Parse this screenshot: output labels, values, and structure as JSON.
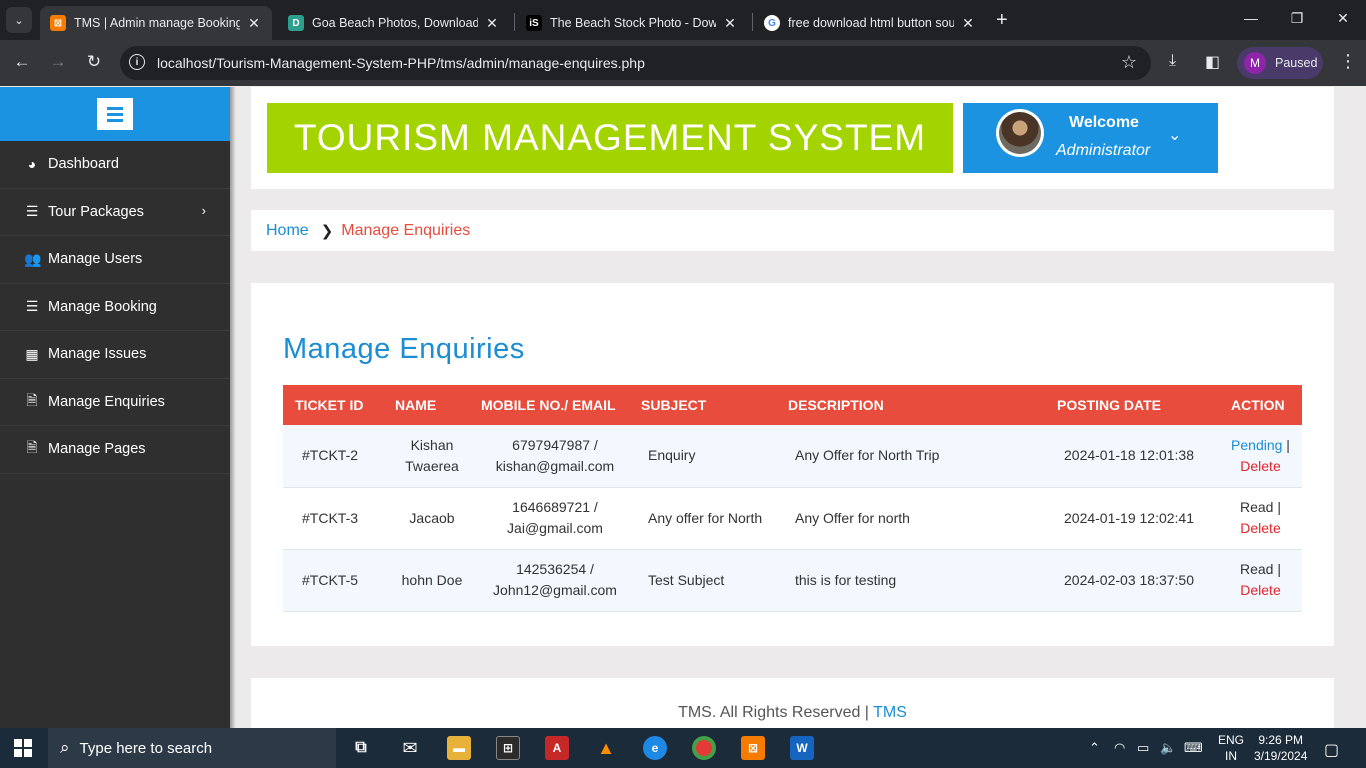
{
  "browser": {
    "tabs": [
      {
        "title": "TMS | Admin manage Bookings",
        "active": true
      },
      {
        "title": "Goa Beach Photos, Download T",
        "active": false
      },
      {
        "title": "The Beach Stock Photo - Downl",
        "active": false
      },
      {
        "title": "free download html button sou",
        "active": false
      }
    ],
    "url": "localhost/Tourism-Management-System-PHP/tms/admin/manage-enquires.php",
    "profile_initial": "M",
    "profile_status": "Paused"
  },
  "sidebar": {
    "items": [
      {
        "label": "Dashboard",
        "icon": "dashboard-icon",
        "glyph": "◕"
      },
      {
        "label": "Tour Packages",
        "icon": "list-icon",
        "glyph": "☰",
        "has_submenu": true
      },
      {
        "label": "Manage Users",
        "icon": "users-icon",
        "glyph": "👥"
      },
      {
        "label": "Manage Booking",
        "icon": "list-icon",
        "glyph": "☰"
      },
      {
        "label": "Manage Issues",
        "icon": "table-icon",
        "glyph": "▦"
      },
      {
        "label": "Manage Enquiries",
        "icon": "file-icon",
        "glyph": "🗎"
      },
      {
        "label": "Manage Pages",
        "icon": "file-icon",
        "glyph": "🗎"
      }
    ]
  },
  "header": {
    "brand": "TOURISM MANAGEMENT SYSTEM",
    "welcome": "Welcome",
    "role": "Administrator"
  },
  "breadcrumb": {
    "home": "Home",
    "current": "Manage Enquiries"
  },
  "main": {
    "title": "Manage Enquiries",
    "columns": [
      "TICKET ID",
      "NAME",
      "MOBILE NO./ EMAIL",
      "SUBJECT",
      "DESCRIPTION",
      "POSTING DATE",
      "ACTION"
    ],
    "rows": [
      {
        "ticket": "#TCKT-2",
        "name": "Kishan Twaerea",
        "contact": "6797947987 / kishan@gmail.com",
        "subject": "Enquiry",
        "description": "Any Offer for North Trip",
        "date": "2024-01-18 12:01:38",
        "status": "Pending",
        "sep": " | ",
        "delete": "Delete"
      },
      {
        "ticket": "#TCKT-3",
        "name": "Jacaob",
        "contact": "1646689721 / Jai@gmail.com",
        "subject": "Any offer for North",
        "description": "Any Offer for north",
        "date": "2024-01-19 12:02:41",
        "status": "Read",
        "sep": " | ",
        "delete": "Delete"
      },
      {
        "ticket": "#TCKT-5",
        "name": "hohn Doe",
        "contact": "142536254 / John12@gmail.com",
        "subject": "Test Subject",
        "description": "this is for testing",
        "date": "2024-02-03 18:37:50",
        "status": "Read",
        "sep": " | ",
        "delete": "Delete"
      }
    ]
  },
  "footer": {
    "text": "TMS. All Rights Reserved | ",
    "link": "TMS"
  },
  "taskbar": {
    "search_placeholder": "Type here to search",
    "lang": "ENG",
    "region": "IN",
    "time": "9:26 PM",
    "date": "3/19/2024"
  },
  "colors": {
    "brand_green": "#a4d400",
    "accent_blue": "#1b93e1",
    "table_header_red": "#e74c3c",
    "sidebar_dark": "#2f2f2f"
  }
}
